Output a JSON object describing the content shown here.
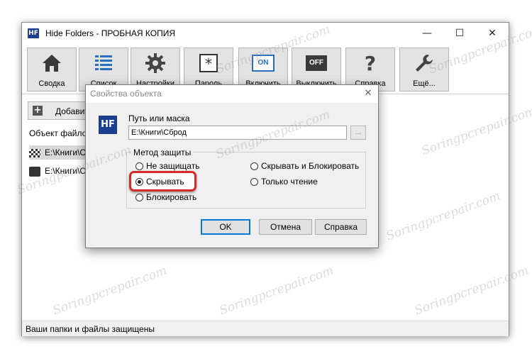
{
  "window": {
    "title": "Hide Folders - ПРОБНАЯ КОПИЯ",
    "app_icon_text": "HF",
    "controls": {
      "minimize": "—",
      "maximize": "☐",
      "close": "✕"
    }
  },
  "toolbar": {
    "buttons": [
      {
        "label": "Сводка",
        "icon": "home-icon"
      },
      {
        "label": "Список",
        "icon": "list-icon"
      },
      {
        "label": "Настройки",
        "icon": "gear-icon"
      },
      {
        "label": "Пароль",
        "icon": "password-icon"
      },
      {
        "label": "Включить",
        "icon": "on-icon",
        "badge": "ON"
      },
      {
        "label": "Выключить",
        "icon": "off-icon",
        "badge": "OFF"
      },
      {
        "label": "Справка",
        "icon": "help-icon",
        "badge": "?"
      },
      {
        "label": "Ещё...",
        "icon": "wrench-icon"
      }
    ]
  },
  "main": {
    "add_button": "Добавить",
    "list_header": "Объект файловой системы",
    "rows": [
      {
        "path": "E:\\Книги\\Сброд"
      },
      {
        "path": "E:\\Книги\\Сброд"
      }
    ]
  },
  "status": {
    "text": "Ваши папки и файлы защищены"
  },
  "dialog": {
    "title": "Свойства объекта",
    "logo_text": "HF",
    "path_label": "Путь или маска",
    "path_value": "E:\\Книги\\Сброд",
    "browse_label": "...",
    "group_title": "Метод защиты",
    "options": [
      {
        "label": "Не защищать",
        "selected": false
      },
      {
        "label": "Скрывать",
        "selected": true
      },
      {
        "label": "Блокировать",
        "selected": false
      },
      {
        "label": "Скрывать и Блокировать",
        "selected": false
      },
      {
        "label": "Только чтение",
        "selected": false
      }
    ],
    "buttons": {
      "ok": "OK",
      "cancel": "Отмена",
      "help": "Справка"
    }
  },
  "watermark": "Soringpcrepair.com",
  "colors": {
    "highlight": "#d42a2a",
    "logo_blue": "#1b3f8f",
    "ok_border": "#0078d7"
  }
}
